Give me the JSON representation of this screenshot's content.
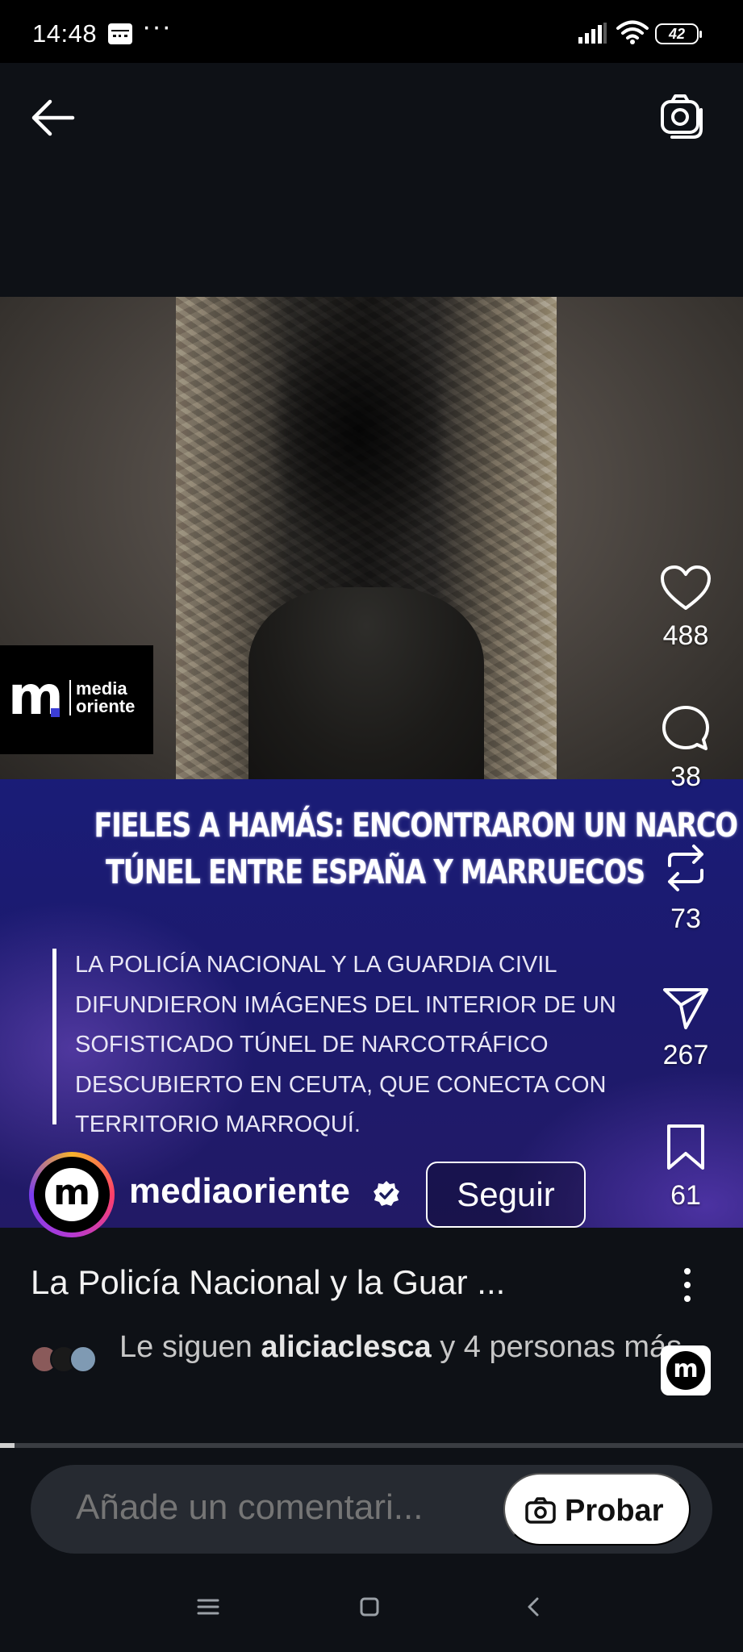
{
  "status_bar": {
    "time": "14:48",
    "more": "···",
    "battery": "42"
  },
  "top_bar": {
    "back_icon": "arrow-left-icon",
    "camera_icon": "camera-flip-icon"
  },
  "video": {
    "logo": {
      "brand_line1": "media",
      "brand_line2": "oriente"
    },
    "headline_line1": "FIELES A HAMÁS: ENCONTRARON UN NARCO",
    "headline_line2": "TÚNEL ENTRE ESPAÑA Y MARRUECOS",
    "body_lines": [
      "LA POLICÍA NACIONAL Y LA GUARDIA CIVIL",
      "DIFUNDIERON IMÁGENES DEL INTERIOR DE UN",
      "SOFISTICADO TÚNEL DE NARCOTRÁFICO",
      "DESCUBIERTO EN CEUTA, QUE CONECTA CON",
      "TERRITORIO MARROQUÍ."
    ]
  },
  "actions": {
    "likes": "488",
    "comments": "38",
    "reposts": "73",
    "shares": "267",
    "saves": "61"
  },
  "author": {
    "name": "mediaoriente",
    "follow_label": "Seguir"
  },
  "caption": "La Policía Nacional y la Guar ...",
  "followers": {
    "prefix": "Le siguen ",
    "user": "aliciaclesca",
    "suffix": " y 4 personas más"
  },
  "progress_fraction": 0.02,
  "comment": {
    "placeholder": "Añade un comentari...",
    "try_label": "Probar"
  },
  "colors": {
    "banner_blue": "#1a1c77",
    "background": "#0e1116",
    "accent_purple": "#3b3dd6"
  }
}
